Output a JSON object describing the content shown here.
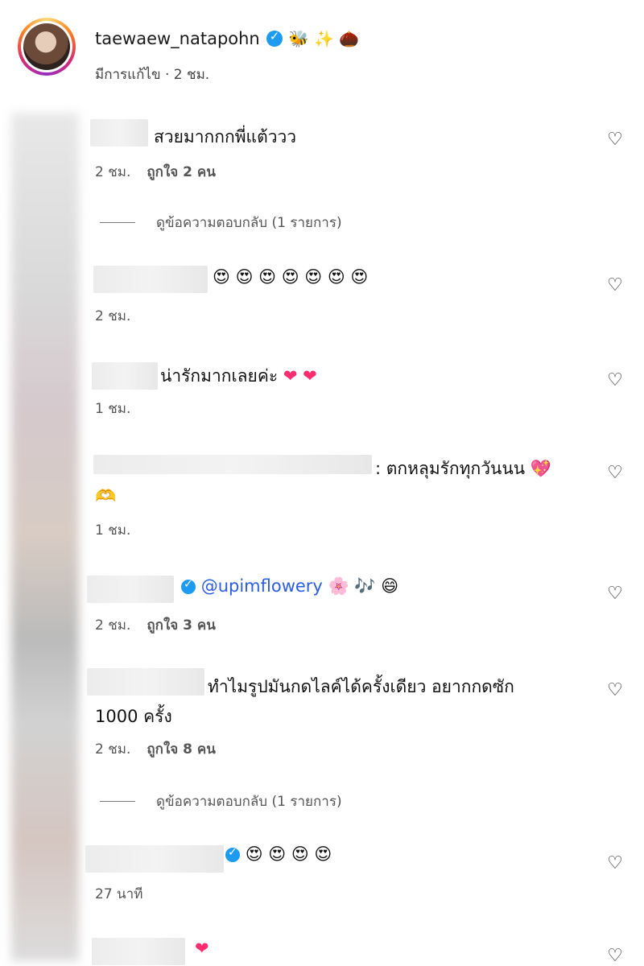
{
  "post": {
    "username": "taewaew_natapohn",
    "header_emojis": "🐝 ✨ 🌰",
    "meta": "มีการแก้ไข · 2 ชม."
  },
  "comments": [
    {
      "text": "สวยมากกกพี่แต้ววว",
      "time": "2 ชม.",
      "likes": "ถูกใจ 2 คน",
      "replies": "ดูข้อความตอบกลับ (1 รายการ)"
    },
    {
      "text": "😍 😍 😍 😍 😍 😍 😍",
      "time": "2 ชม."
    },
    {
      "text": "น่ารักมากเลยค่ะ",
      "hearts": "❤ ❤",
      "time": "1 ชม."
    },
    {
      "text": ": ตกหลุมรักทุกวันนน",
      "emoji_line1": "💖",
      "emoji_line2": "🫶",
      "time": "1 ชม."
    },
    {
      "mention": "@upimflowery",
      "emojis": "🌸 🎶 😄",
      "time": "2 ชม.",
      "likes": "ถูกใจ 3 คน"
    },
    {
      "text_line1": "ทำไมรูปมันกดไลค์ได้ครั้งเดียว อยากกดซัก",
      "text_line2": "1000 ครั้ง",
      "time": "2 ชม.",
      "likes": "ถูกใจ 8 คน",
      "replies": "ดูข้อความตอบกลับ (1 รายการ)"
    },
    {
      "emojis": "😍 😍 😍 😍",
      "time": "27 นาที"
    },
    {
      "emojis": "❤"
    }
  ],
  "icons": {
    "like": "heart-outline-icon",
    "verified": "verified-badge-icon"
  }
}
